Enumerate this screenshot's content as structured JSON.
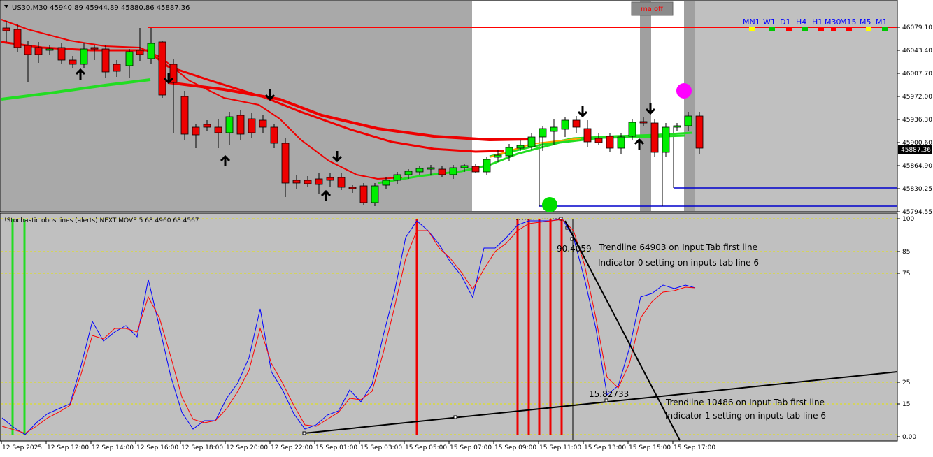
{
  "main_chart": {
    "header_text": "US30,M30  45940.89 45944.89 45880.86 45887.36",
    "ma_toggle_label": "ma off",
    "current_price_label": "45887.36",
    "timeframes": [
      {
        "label": "MN1",
        "signal_color": "#ffff00"
      },
      {
        "label": "W1",
        "signal_color": "#00c800"
      },
      {
        "label": "D1",
        "signal_color": "#ff0000"
      },
      {
        "label": "H4",
        "signal_color": "#00c800"
      },
      {
        "label": "H1",
        "signal_color": "#ff0000"
      },
      {
        "label": "M30",
        "signal_color": "#ff0000"
      },
      {
        "label": "M15",
        "signal_color": "#ff0000"
      },
      {
        "label": "M5",
        "signal_color": "#ffff00"
      },
      {
        "label": "M1",
        "signal_color": "#00c800"
      }
    ],
    "price_axis": [
      "46079.10",
      "46043.40",
      "46007.70",
      "45972.00",
      "45936.30",
      "45900.60",
      "45864.90",
      "45830.25",
      "45794.55"
    ]
  },
  "indicator_panel": {
    "title": "!Stochastic obos lines (alerts) NEXT MOVE 5 68.4960 68.4567",
    "peak_value_label": "90.4059",
    "trough_value_label": "15.82733",
    "trendline_1_line1": "Trendline 64903 on Input Tab first line",
    "trendline_1_line2": "Indicator 0 setting on inputs tab line 6",
    "trendline_2_line1": "Trendline 10486 on Input Tab first line",
    "trendline_2_line2": "Indicator 1 setting on inputs tab line 6",
    "level_axis": [
      "100",
      "85",
      "75",
      "25",
      "15",
      "0.00"
    ]
  },
  "time_axis": [
    "12 Sep 2025",
    "12 Sep 12:00",
    "12 Sep 14:00",
    "12 Sep 16:00",
    "12 Sep 18:00",
    "12 Sep 20:00",
    "12 Sep 22:00",
    "15 Sep 01:00",
    "15 Sep 03:00",
    "15 Sep 05:00",
    "15 Sep 07:00",
    "15 Sep 09:00",
    "15 Sep 11:00",
    "15 Sep 13:00",
    "15 Sep 15:00",
    "15 Sep 17:00"
  ],
  "colors": {
    "bull_candle": "#00ee00",
    "bear_candle": "#ee0000",
    "stoch_main": "#0000ff",
    "stoch_signal": "#ff0000",
    "obos_line": "#e6e600"
  }
}
